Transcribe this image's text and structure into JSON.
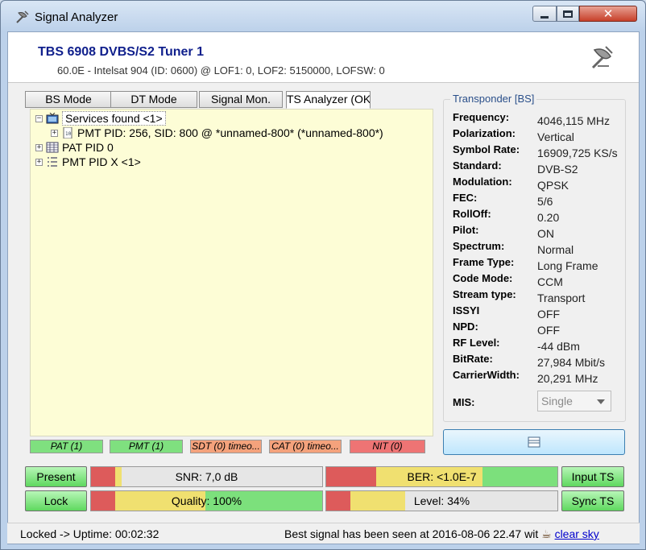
{
  "window": {
    "title": "Signal Analyzer"
  },
  "header": {
    "tuner_name": "TBS 6908 DVBS/S2 Tuner 1",
    "tuner_info": "60.0E - Intelsat 904 (ID: 0600) @ LOF1: 0, LOF2: 5150000, LOFSW: 0"
  },
  "tabs": [
    {
      "label": "BS Mode"
    },
    {
      "label": "DT Mode"
    },
    {
      "label": "Signal Mon."
    },
    {
      "label": "TS Analyzer (OK"
    }
  ],
  "tree": {
    "root": "Services found <1>",
    "service": "PMT PID: 256, SID: 800 @ *unnamed-800* (*unnamed-800*)",
    "pat": "PAT PID 0",
    "pmt": "PMT PID X <1>"
  },
  "tables": [
    {
      "label": "PAT (1)",
      "color": "#7fe07f"
    },
    {
      "label": "PMT (1)",
      "color": "#7fe07f"
    },
    {
      "label": "SDT (0) timeo...",
      "color": "#f4a27c"
    },
    {
      "label": "CAT (0) timeo...",
      "color": "#f4a27c"
    },
    {
      "label": "NIT (0)",
      "color": "#ee7474"
    }
  ],
  "transponder": {
    "title": "Transponder [BS]",
    "fields": [
      {
        "label": "Frequency:",
        "value": "4046,115 MHz"
      },
      {
        "label": "Polarization:",
        "value": "Vertical"
      },
      {
        "label": "Symbol Rate:",
        "value": "16909,725 KS/s"
      },
      {
        "label": "Standard:",
        "value": "DVB-S2"
      },
      {
        "label": "Modulation:",
        "value": "QPSK"
      },
      {
        "label": "FEC:",
        "value": "5/6"
      },
      {
        "label": "RollOff:",
        "value": "0.20"
      },
      {
        "label": "Pilot:",
        "value": "ON"
      },
      {
        "label": "Spectrum:",
        "value": "Normal"
      },
      {
        "label": "Frame Type:",
        "value": "Long Frame"
      },
      {
        "label": "Code Mode:",
        "value": "CCM"
      },
      {
        "label": "Stream type:",
        "value": "Transport"
      },
      {
        "label": "ISSYI",
        "value": "OFF"
      },
      {
        "label": "NPD:",
        "value": "OFF"
      },
      {
        "label": "RF Level:",
        "value": "-44 dBm"
      },
      {
        "label": "BitRate:",
        "value": "27,984 Mbit/s"
      },
      {
        "label": "CarrierWidth:",
        "value": "20,291 MHz"
      }
    ],
    "mis_label": "MIS:",
    "mis_value": "Single"
  },
  "indicators": {
    "present": "Present",
    "lock": "Lock",
    "input_ts": "Input TS",
    "sync_ts": "Sync TS"
  },
  "meters": {
    "snr": {
      "text": "SNR: 7,0 dB",
      "fill": 0.14
    },
    "quality": {
      "text": "Quality: 100%",
      "fill": 1.0
    },
    "ber": {
      "text": "BER: <1.0E-7",
      "fill": 1.0
    },
    "level": {
      "text": "Level: 34%",
      "fill": 0.34
    }
  },
  "colors": {
    "accent_blue": "#0f1f8c",
    "green": "#7fe07f",
    "orange": "#f4a27c",
    "red": "#ee7474"
  },
  "status": {
    "left": "Locked -> Uptime: 00:02:32",
    "right": "Best signal has been seen at 2016-08-06 22.47 wit",
    "link": "clear sky"
  }
}
